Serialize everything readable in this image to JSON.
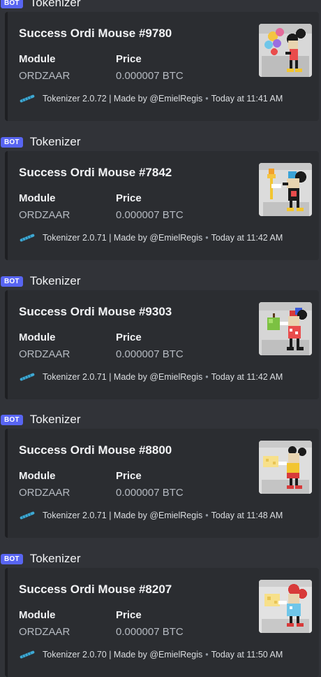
{
  "messages": [
    {
      "bot_tag": "BOT",
      "author": "Tokenizer",
      "title": "Success Ordi Mouse #9780",
      "fields": [
        {
          "name": "Module",
          "value": "ORDZAAR"
        },
        {
          "name": "Price",
          "value": "0.000007 BTC"
        }
      ],
      "footer": "Tokenizer 2.0.72 | Made by @EmielRegis",
      "separator": "•",
      "time": "Today at 11:41 AM",
      "thumb_icon": "pixel-mouse-balloons-thumbnail"
    },
    {
      "bot_tag": "BOT",
      "author": "Tokenizer",
      "title": "Success Ordi Mouse #7842",
      "fields": [
        {
          "name": "Module",
          "value": "ORDZAAR"
        },
        {
          "name": "Price",
          "value": "0.000007 BTC"
        }
      ],
      "footer": "Tokenizer 2.0.71 | Made by @EmielRegis",
      "separator": "•",
      "time": "Today at 11:42 AM",
      "thumb_icon": "pixel-mouse-torch-thumbnail"
    },
    {
      "bot_tag": "BOT",
      "author": "Tokenizer",
      "title": "Success Ordi Mouse #9303",
      "fields": [
        {
          "name": "Module",
          "value": "ORDZAAR"
        },
        {
          "name": "Price",
          "value": "0.000007 BTC"
        }
      ],
      "footer": "Tokenizer 2.0.71 | Made by @EmielRegis",
      "separator": "•",
      "time": "Today at 11:42 AM",
      "thumb_icon": "pixel-mouse-apple-thumbnail"
    },
    {
      "bot_tag": "BOT",
      "author": "Tokenizer",
      "title": "Success Ordi Mouse #8800",
      "fields": [
        {
          "name": "Module",
          "value": "ORDZAAR"
        },
        {
          "name": "Price",
          "value": "0.000007 BTC"
        }
      ],
      "footer": "Tokenizer 2.0.71 | Made by @EmielRegis",
      "separator": "•",
      "time": "Today at 11:48 AM",
      "thumb_icon": "pixel-mouse-cheese-thumbnail"
    },
    {
      "bot_tag": "BOT",
      "author": "Tokenizer",
      "title": "Success Ordi Mouse #8207",
      "fields": [
        {
          "name": "Module",
          "value": "ORDZAAR"
        },
        {
          "name": "Price",
          "value": "0.000007 BTC"
        }
      ],
      "footer": "Tokenizer 2.0.70 | Made by @EmielRegis",
      "separator": "•",
      "time": "Today at 11:50 AM",
      "thumb_icon": "pixel-mouse-cheese-red-thumbnail"
    }
  ],
  "colors": {
    "background": "#313338",
    "embed_background": "#2b2d31",
    "bot_tag": "#5865f2",
    "footer_icon": "#3fa9d4"
  }
}
